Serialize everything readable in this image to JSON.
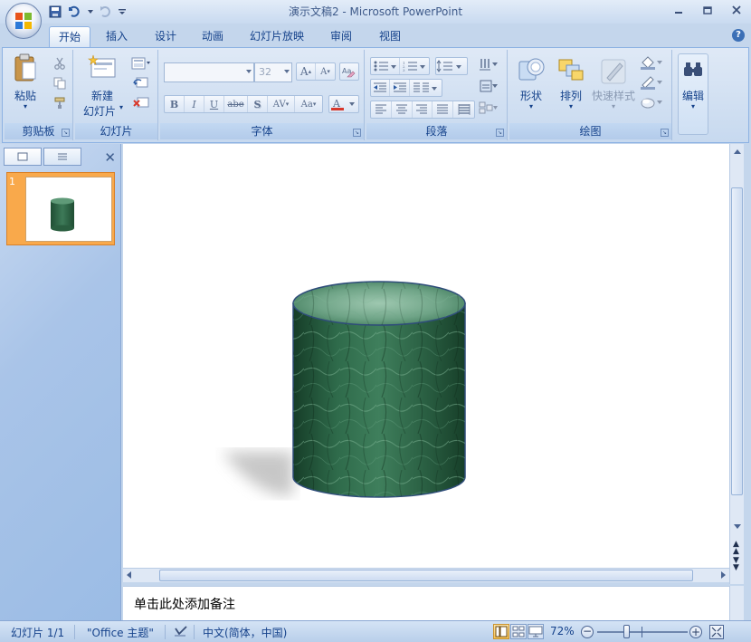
{
  "window": {
    "title": "演示文稿2 - Microsoft PowerPoint"
  },
  "tabs": [
    {
      "label": "开始",
      "active": true
    },
    {
      "label": "插入"
    },
    {
      "label": "设计"
    },
    {
      "label": "动画"
    },
    {
      "label": "幻灯片放映"
    },
    {
      "label": "审阅"
    },
    {
      "label": "视图"
    }
  ],
  "ribbon": {
    "clipboard": {
      "paste_label": "粘贴",
      "group_label": "剪贴板"
    },
    "slides": {
      "new_slide_label_1": "新建",
      "new_slide_label_2": "幻灯片",
      "group_label": "幻灯片"
    },
    "font": {
      "font_name": "",
      "font_size": "32",
      "group_label": "字体"
    },
    "paragraph": {
      "group_label": "段落"
    },
    "drawing": {
      "shapes_label": "形状",
      "arrange_label": "排列",
      "quick_styles_label": "快速样式",
      "group_label": "绘图"
    },
    "editing": {
      "edit_label": "编辑"
    }
  },
  "slides_pane": {
    "slide_number": "1"
  },
  "notes": {
    "placeholder": "单击此处添加备注"
  },
  "statusbar": {
    "slide_info": "幻灯片 1/1",
    "theme": "\"Office 主题\"",
    "language": "中文(简体，中国)",
    "zoom": "72%"
  },
  "colors": {
    "cylinder_dark": "#1f4d33",
    "cylinder_light": "#5f9a78",
    "cylinder_outline": "#2f4d7a",
    "accent": "#f9a94b"
  }
}
